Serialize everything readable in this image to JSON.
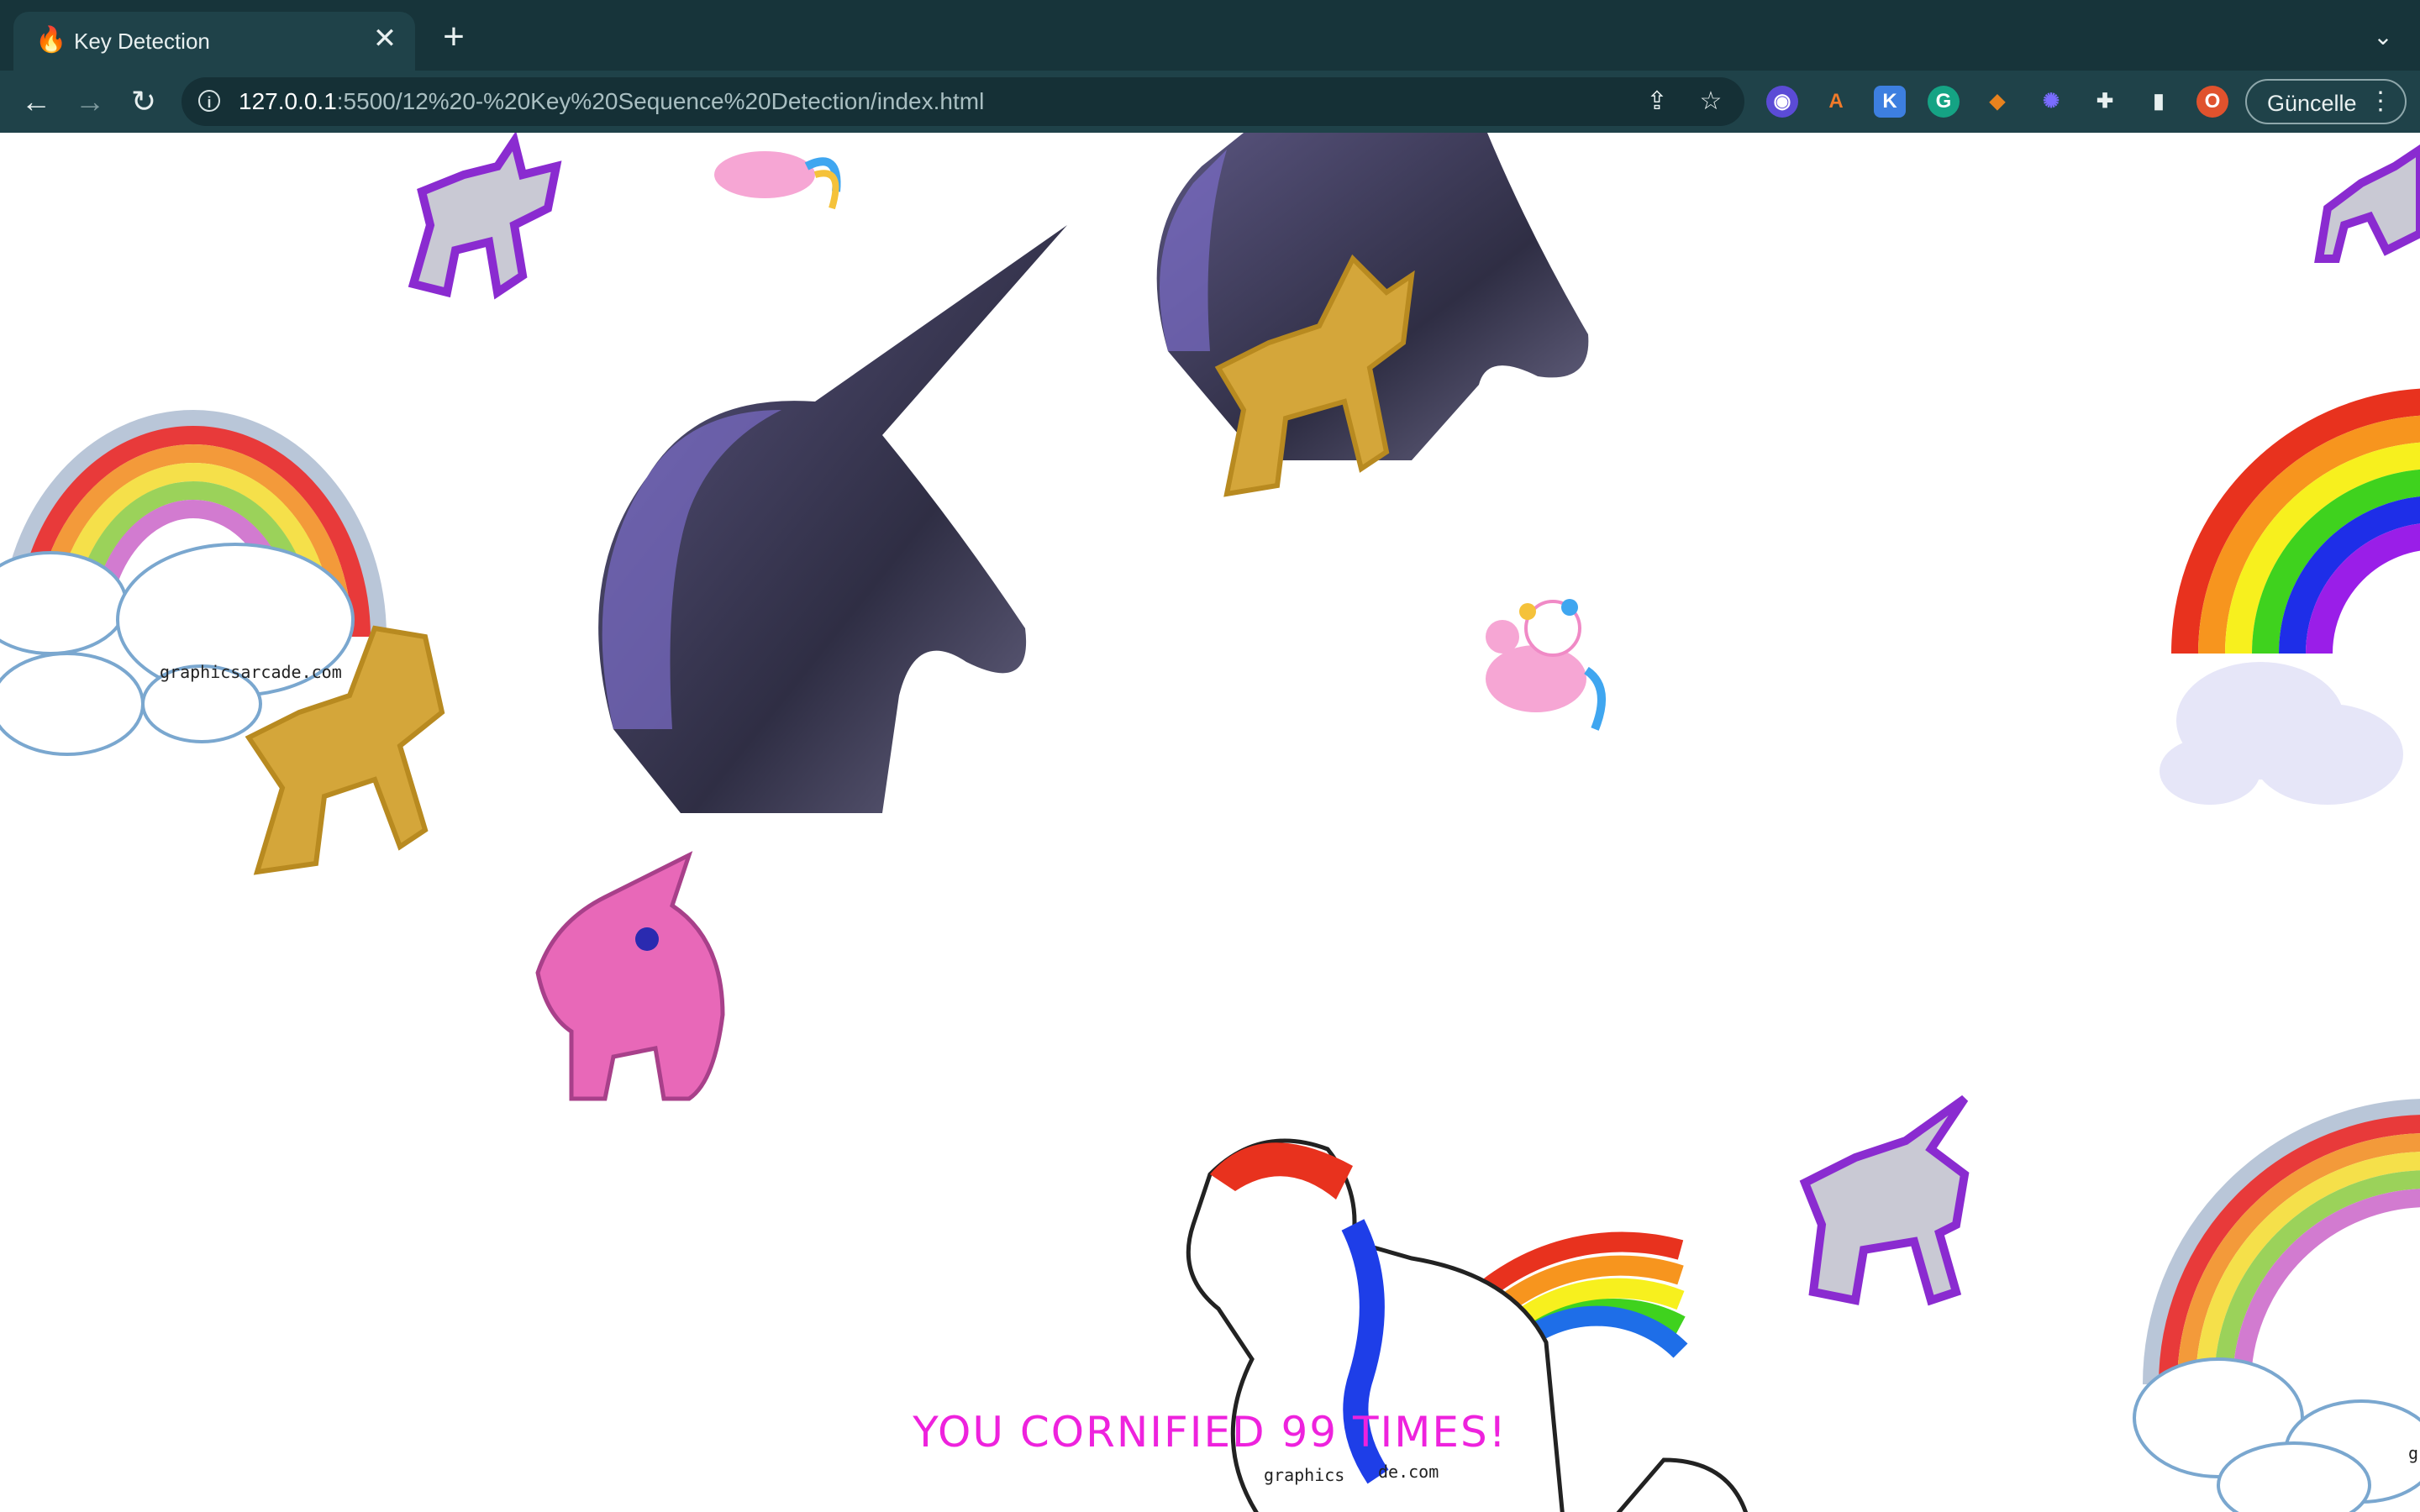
{
  "browser": {
    "tab": {
      "title": "Key Detection",
      "favicon": "fire-icon",
      "close_glyph": "✕"
    },
    "new_tab_glyph": "+",
    "tab_menu_glyph": "⌄",
    "toolbar": {
      "back_glyph": "←",
      "forward_glyph": "→",
      "reload_glyph": "↻",
      "url_host": "127.0.0.1",
      "url_rest": ":5500/12%20-%20Key%20Sequence%20Detection/index.html",
      "share_glyph": "⇪",
      "bookmark_glyph": "☆",
      "extensions": [
        {
          "name": "ghost-extension-icon",
          "glyph": "◉",
          "color": "#5b4bd6"
        },
        {
          "name": "a-extension-icon",
          "glyph": "A",
          "color": "#f07a2a"
        },
        {
          "name": "k-extension-icon",
          "glyph": "K",
          "color": "#3d7fe0"
        },
        {
          "name": "grammarly-extension-icon",
          "glyph": "G",
          "color": "#15a384"
        },
        {
          "name": "metamask-extension-icon",
          "glyph": "◆",
          "color": "#e8821e"
        },
        {
          "name": "gear-extension-icon",
          "glyph": "✺",
          "color": "#6a5cf0"
        }
      ],
      "puzzle_glyph": "✚",
      "sidepanel_glyph": "▮",
      "profile_initial": "O",
      "profile_color": "#e0522d",
      "update_label": "Güncelle",
      "update_menu_glyph": "⋮"
    }
  },
  "page": {
    "result_message": "YOU CORNIFIED 99 TIMES!",
    "watermark": "graphicsarcade.com",
    "watermark_partial_1": "graphics",
    "watermark_partial_2": "de.com",
    "watermark_partial_3": "g"
  }
}
